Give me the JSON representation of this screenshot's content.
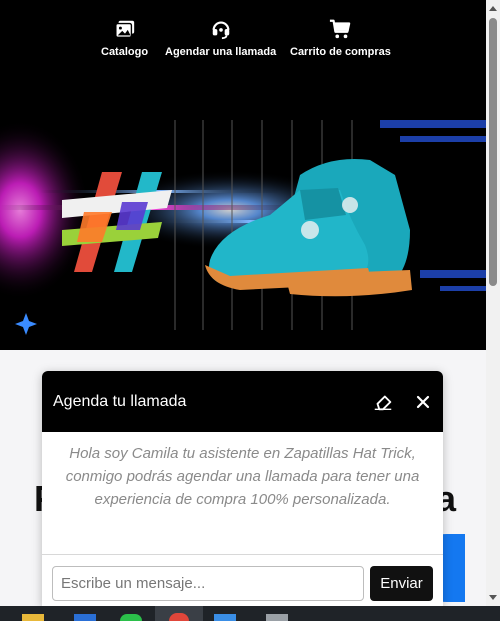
{
  "nav": {
    "items": [
      {
        "label": "Catalogo",
        "icon": "image-gallery-icon"
      },
      {
        "label": "Agendar una llamada",
        "icon": "headset-icon"
      },
      {
        "label": "Carrito de compras",
        "icon": "shopping-cart-icon"
      }
    ]
  },
  "hero": {
    "brand_mark": "hashtag-logo",
    "product": "turquoise-sneaker",
    "colors": {
      "shoe": "#21b6c9",
      "sole": "#e08a3c",
      "glow_pink": "#ff2bd6",
      "glow_blue": "#3a8bff"
    }
  },
  "page": {
    "heading_left": "P",
    "heading_right": "a"
  },
  "chat": {
    "title": "Agenda tu llamada",
    "message": "Hola soy Camila tu asistente en Zapatillas Hat Trick, conmigo podrás agendar una llamada para tener una experiencia de compra 100% personalizada.",
    "input_placeholder": "Escribe un mensaje...",
    "send_label": "Enviar"
  },
  "colors": {
    "accent_blue": "#1478f0",
    "header_black": "#000000"
  }
}
